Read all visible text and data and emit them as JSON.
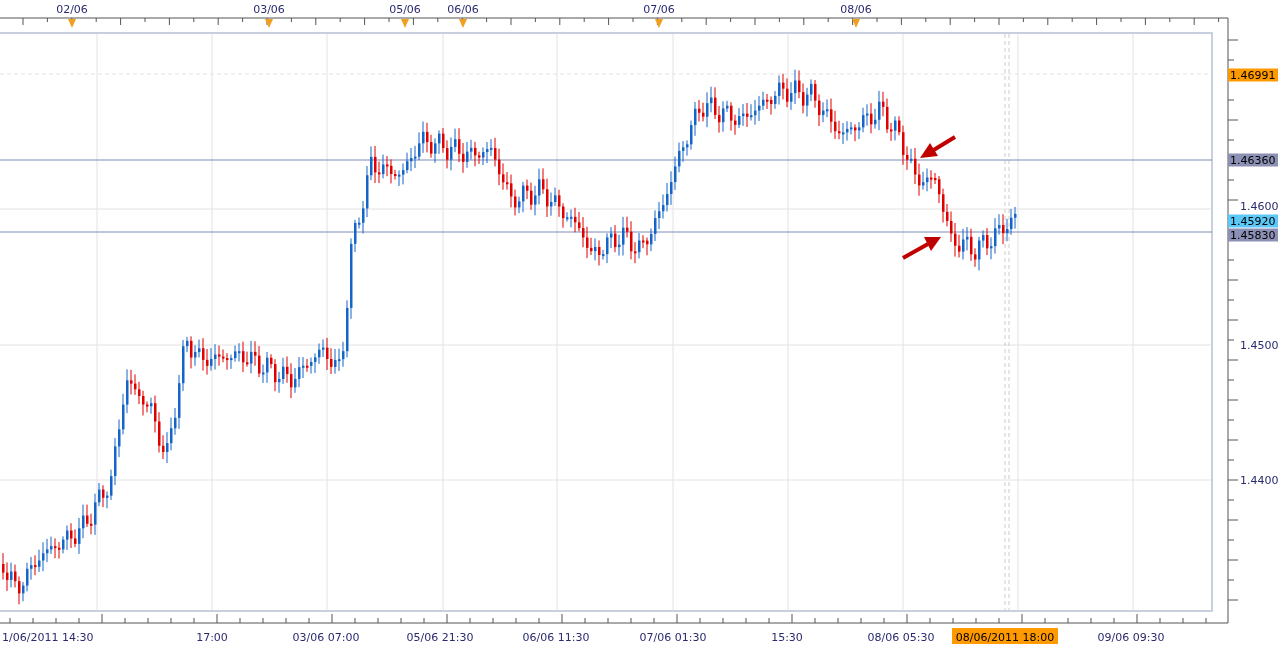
{
  "chart": {
    "date_markers": [
      "02/06",
      "03/06",
      "05/06",
      "06/06",
      "07/06",
      "08/06"
    ],
    "price_ticks": [
      "1.4600",
      "1.4500",
      "1.4400"
    ],
    "price_tags": [
      {
        "label": "1.46991",
        "color": "#ff9900"
      },
      {
        "label": "1.46360",
        "color": "#8b90b4"
      },
      {
        "label": "1.45920",
        "color": "#5cc8f7"
      },
      {
        "label": "1.45830",
        "color": "#8b90b4"
      }
    ],
    "time_labels": [
      "1/06/2011 14:30",
      "17:00",
      "03/06 07:00",
      "05/06 21:30",
      "06/06 11:30",
      "07/06 01:30",
      "15:30",
      "08/06 05:30",
      "09/06 09:30"
    ],
    "cursor_time": {
      "label": "08/06/2011 18:00",
      "color": "#ff9900"
    }
  }
}
